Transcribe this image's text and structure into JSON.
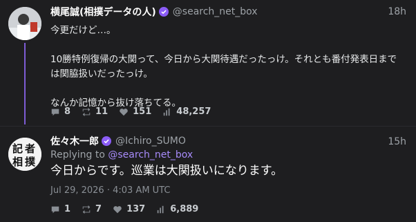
{
  "tweets": [
    {
      "name": "横尾誠(相撲データの人)",
      "handle": "@search_net_box",
      "time": "18h",
      "lines": [
        "今更だけど…。",
        "",
        "10勝特例復帰の大関って、今日から大関待遇だったっけ。それとも番付発表日まで",
        "は関脇扱いだったっけ。",
        "",
        "なんか記憶から抜け落ちてる。"
      ],
      "replies": "8",
      "retweets": "11",
      "likes": "151",
      "views": "48,257"
    },
    {
      "name": "佐々木一郎",
      "handle": "@Ichiro_SUMO",
      "time": "15h",
      "reply_prefix": "Replying to ",
      "reply_mention": "@search_net_box",
      "text": "今日からです。巡業は大関扱いになります。",
      "date": "Jul 29, 2026 · 4:03 AM UTC",
      "replies": "1",
      "retweets": "7",
      "likes": "137",
      "views": "6,889"
    }
  ],
  "avatar_text": "記者",
  "colors": {
    "background": "#1e1e20",
    "accent": "#7e5cd6",
    "verified": "#8b5cf6",
    "muted": "#9ea3a8"
  },
  "icons": [
    "comment-icon",
    "retweet-icon",
    "heart-icon",
    "views-icon",
    "verified-icon"
  ]
}
